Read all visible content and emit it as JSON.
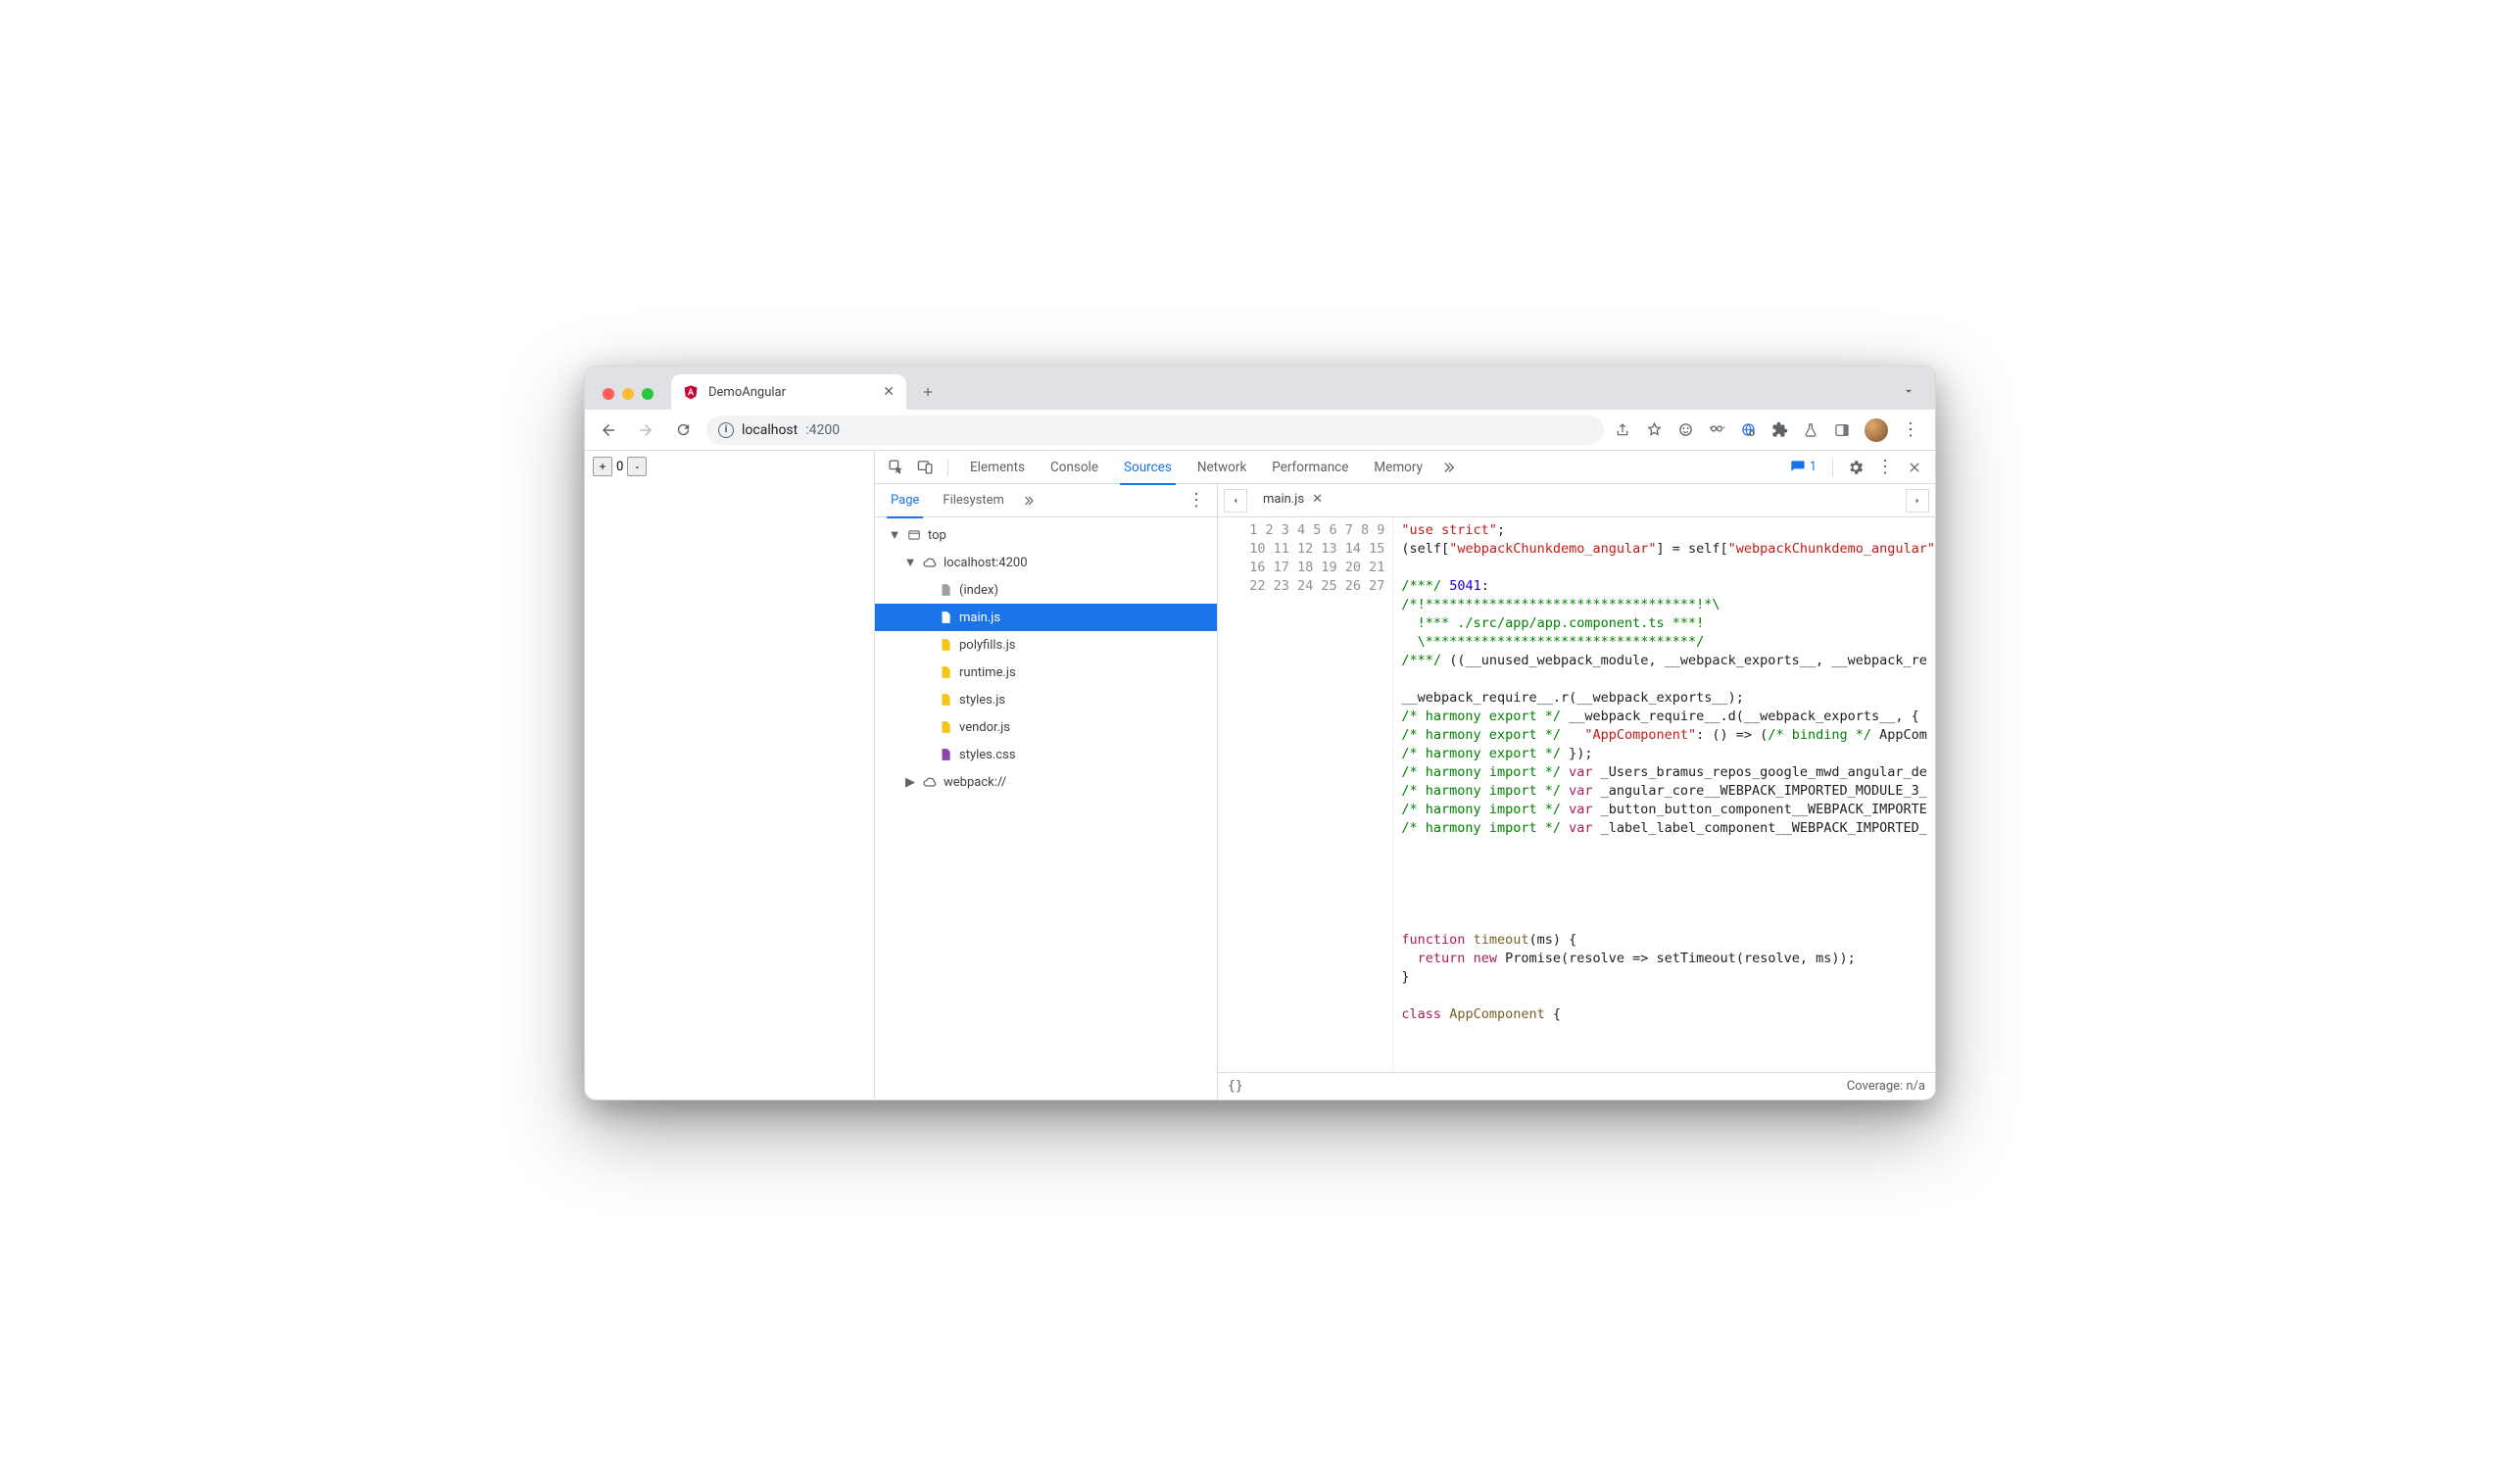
{
  "browser": {
    "tab_title": "DemoAngular",
    "url_host": "localhost",
    "url_port": ":4200"
  },
  "page": {
    "counter_value": "0"
  },
  "devtools": {
    "tabs": [
      "Elements",
      "Console",
      "Sources",
      "Network",
      "Performance",
      "Memory"
    ],
    "active_tab": "Sources",
    "issues_count": "1",
    "sources": {
      "sidebar_tabs": [
        "Page",
        "Filesystem"
      ],
      "active_sidebar_tab": "Page",
      "tree": {
        "top": "top",
        "origin": "localhost:4200",
        "files": [
          "(index)",
          "main.js",
          "polyfills.js",
          "runtime.js",
          "styles.js",
          "vendor.js",
          "styles.css"
        ],
        "selected": "main.js",
        "webpack": "webpack://"
      },
      "open_file": "main.js",
      "code_lines": [
        [
          [
            "str",
            "\"use strict\""
          ],
          [
            "id",
            ";"
          ]
        ],
        [
          [
            "id",
            "(self["
          ],
          [
            "str",
            "\"webpackChunkdemo_angular\""
          ],
          [
            "id",
            "] = self["
          ],
          [
            "str",
            "\"webpackChunkdemo_angular\""
          ]
        ],
        [],
        [
          [
            "com",
            "/***/ "
          ],
          [
            "num",
            "5041"
          ],
          [
            "id",
            ":"
          ]
        ],
        [
          [
            "com",
            "/*!**********************************!*\\"
          ]
        ],
        [
          [
            "com",
            "  !*** ./src/app/app.component.ts ***!"
          ]
        ],
        [
          [
            "com",
            "  \\**********************************/"
          ]
        ],
        [
          [
            "com",
            "/***/ "
          ],
          [
            "id",
            "((__unused_webpack_module, __webpack_exports__, __webpack_re"
          ]
        ],
        [],
        [
          [
            "id",
            "__webpack_require__.r(__webpack_exports__);"
          ]
        ],
        [
          [
            "com",
            "/* harmony export */"
          ],
          [
            "id",
            " __webpack_require__.d(__webpack_exports__, {"
          ]
        ],
        [
          [
            "com",
            "/* harmony export */"
          ],
          [
            "id",
            "   "
          ],
          [
            "str",
            "\"AppComponent\""
          ],
          [
            "id",
            ": () => ("
          ],
          [
            "com",
            "/* binding */"
          ],
          [
            "id",
            " AppCom"
          ]
        ],
        [
          [
            "com",
            "/* harmony export */"
          ],
          [
            "id",
            " });"
          ]
        ],
        [
          [
            "com",
            "/* harmony import */"
          ],
          [
            "id",
            " "
          ],
          [
            "kw",
            "var"
          ],
          [
            "id",
            " _Users_bramus_repos_google_mwd_angular_de"
          ]
        ],
        [
          [
            "com",
            "/* harmony import */"
          ],
          [
            "id",
            " "
          ],
          [
            "kw",
            "var"
          ],
          [
            "id",
            " _angular_core__WEBPACK_IMPORTED_MODULE_3_"
          ]
        ],
        [
          [
            "com",
            "/* harmony import */"
          ],
          [
            "id",
            " "
          ],
          [
            "kw",
            "var"
          ],
          [
            "id",
            " _button_button_component__WEBPACK_IMPORTE"
          ]
        ],
        [
          [
            "com",
            "/* harmony import */"
          ],
          [
            "id",
            " "
          ],
          [
            "kw",
            "var"
          ],
          [
            "id",
            " _label_label_component__WEBPACK_IMPORTED_"
          ]
        ],
        [],
        [],
        [],
        [],
        [],
        [
          [
            "kw",
            "function"
          ],
          [
            "id",
            " "
          ],
          [
            "fn",
            "timeout"
          ],
          [
            "id",
            "(ms) {"
          ]
        ],
        [
          [
            "id",
            "  "
          ],
          [
            "kw",
            "return"
          ],
          [
            "id",
            " "
          ],
          [
            "kw",
            "new"
          ],
          [
            "id",
            " Promise(resolve => setTimeout(resolve, ms));"
          ]
        ],
        [
          [
            "id",
            "}"
          ]
        ],
        [],
        [
          [
            "kw",
            "class"
          ],
          [
            "id",
            " "
          ],
          [
            "fn",
            "AppComponent"
          ],
          [
            "id",
            " {"
          ]
        ]
      ],
      "status": {
        "format_label": "{}",
        "coverage": "Coverage: n/a"
      }
    }
  }
}
